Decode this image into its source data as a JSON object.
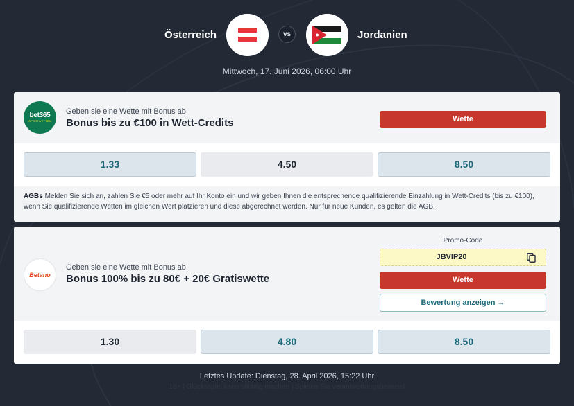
{
  "match": {
    "home_team": "Österreich",
    "away_team": "Jordanien",
    "vs_label": "vs",
    "date": "Mittwoch, 17. Juni 2026, 06:00 Uhr",
    "home_flag_icon": "flag-austria-icon",
    "away_flag_icon": "flag-jordan-icon"
  },
  "offers": [
    {
      "bookmaker_icon": "bet365-logo",
      "logo_main": "bet365",
      "logo_sub": "SPORTWETTEN",
      "subtitle": "Geben sie eine Wette mit Bonus ab",
      "title": "Bonus bis zu €100 in Wett-Credits",
      "bet_label": "Wette",
      "odds": [
        "1.33",
        "4.50",
        "8.50"
      ],
      "terms_label": "AGBs",
      "terms_text": " Melden Sie sich an, zahlen Sie €5 oder mehr auf Ihr Konto ein und wir geben Ihnen die entsprechende qualifizierende Einzahlung in Wett-Credits (bis zu €100), wenn Sie qualifizierende Wetten im gleichen Wert platzieren und diese abgerechnet werden. Nur für neue Kunden, es gelten die AGB."
    },
    {
      "bookmaker_icon": "betano-logo",
      "logo_main": "Betano",
      "subtitle": "Geben sie eine Wette mit Bonus ab",
      "title": "Bonus 100% bis zu 80€ + 20€ Gratiswette",
      "promo_label": "Promo-Code",
      "promo_code": "JBVIP20",
      "bet_label": "Wette",
      "review_label": "Bewertung anzeigen →",
      "odds": [
        "1.30",
        "4.80",
        "8.50"
      ]
    }
  ],
  "footer": {
    "last_update": "Letztes Update: Dienstag, 28. April 2026, 15:22 Uhr",
    "note": "18+ | Glücksspiel kann süchtig machen | Spielen Sie verantwortungsbewusst"
  },
  "colors": {
    "background": "#232a36",
    "bet_button": "#c8372d",
    "highlight_odd": "#dce5ec",
    "accent_teal": "#1e6a78",
    "promo_box": "#fdf9c6"
  }
}
